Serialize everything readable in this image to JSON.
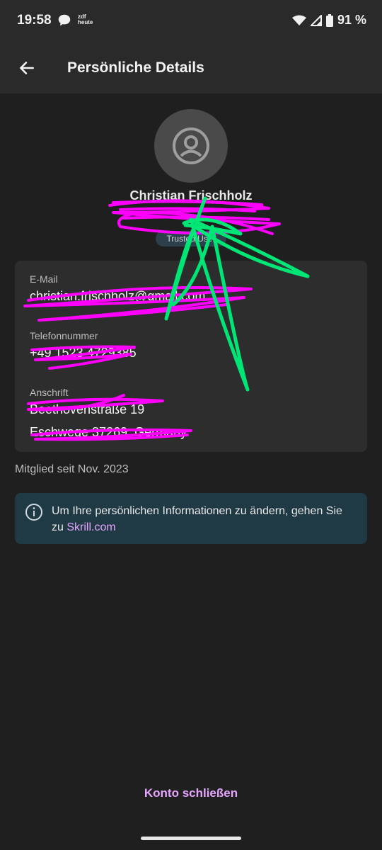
{
  "status_bar": {
    "time": "19:58",
    "zdf_line1": "zdf",
    "zdf_line2": "heute",
    "battery": "91 %",
    "icons": [
      "chat-bubble-icon",
      "wifi-icon",
      "signal-icon",
      "battery-icon"
    ]
  },
  "app_bar": {
    "title": "Persönliche Details",
    "back_icon": "arrow-left-icon"
  },
  "profile": {
    "avatar_icon": "user-circle-icon",
    "name": "Christian Frischholz",
    "account_id": "",
    "badge": "Trusted User"
  },
  "details": {
    "email_label": "E-Mail",
    "email_value": "christian.frischholz@gmail.com",
    "phone_label": "Telefonnummer",
    "phone_value": "+49 1523 4729385",
    "address_label": "Anschrift",
    "address_line1": "Beethovenstraße 19",
    "address_line2": "Eschwege 37269, Germany"
  },
  "member_since": "Mitglied seit Nov. 2023",
  "info": {
    "icon": "info-icon",
    "text": "Um Ihre persönlichen Informationen zu ändern, gehen Sie zu ",
    "link": "Skrill.com"
  },
  "footer": {
    "close_account": "Konto schließen"
  },
  "colors": {
    "background": "#1f1f1f",
    "bar": "#2a2a2a",
    "card": "#2d2d2d",
    "info_bg": "#1f3a44",
    "accent": "#e6a4ff",
    "scribble_magenta": "#ff00ff",
    "scribble_green": "#00e676"
  }
}
